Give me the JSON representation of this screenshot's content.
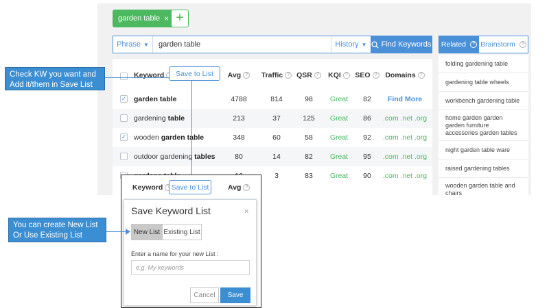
{
  "tag": {
    "label": "garden table",
    "close": "×"
  },
  "add_tag": "+",
  "search": {
    "mode": "Phrase",
    "query": "garden table",
    "history": "History",
    "find_button": "Find Keywords"
  },
  "table": {
    "columns": {
      "keyword": "Keyword",
      "save": "Save to List",
      "avg": "Avg",
      "traffic": "Traffic",
      "qsr": "QSR",
      "kqi": "KQI",
      "seo": "SEO",
      "domains": "Domains"
    },
    "rows": [
      {
        "checked": true,
        "kw_pre": "",
        "kw_bold": "garden table",
        "kw_post": "",
        "avg": "4788",
        "traffic": "814",
        "qsr": "98",
        "kqi": "Great",
        "seo": "82",
        "domains": "Find More"
      },
      {
        "checked": false,
        "kw_pre": "gardening ",
        "kw_bold": "table",
        "kw_post": "",
        "avg": "213",
        "traffic": "37",
        "qsr": "125",
        "kqi": "Great",
        "seo": "86",
        "domains": ".com .net .org"
      },
      {
        "checked": true,
        "kw_pre": "wooden ",
        "kw_bold": "garden table",
        "kw_post": "",
        "avg": "348",
        "traffic": "60",
        "qsr": "58",
        "kqi": "Great",
        "seo": "92",
        "domains": ".com .net .org"
      },
      {
        "checked": false,
        "kw_pre": "outdoor gardening ",
        "kw_bold": "tables",
        "kw_post": "",
        "avg": "80",
        "traffic": "14",
        "qsr": "82",
        "kqi": "Great",
        "seo": "95",
        "domains": ".com .net .org"
      },
      {
        "checked": false,
        "kw_pre": "",
        "kw_bold": "gardens table",
        "kw_post": "",
        "avg": "16",
        "traffic": "3",
        "qsr": "83",
        "kqi": "Great",
        "seo": "90",
        "domains": ".com .net .org"
      }
    ]
  },
  "related": {
    "tab_related": "Related",
    "tab_brainstorm": "Brainstorm",
    "items": [
      "folding gardening table",
      "gardening table wheels",
      "workbench gardening table",
      "home garden garden garden furniture accessories garden tables",
      "night garden table ware",
      "raised gardening tables",
      "wooden garden table and chairs"
    ]
  },
  "callouts": {
    "top": "Check KW you want and Add it/them in Save List",
    "bottom": "You can create New List Or Use Existing List"
  },
  "popup": {
    "keyword": "Keyword",
    "save": "Save to List",
    "avg": "Avg",
    "title": "Save Keyword List",
    "close": "×",
    "new_list": "New List",
    "existing_list": "Existing List",
    "label": "Enter a name for your new List :",
    "placeholder": "e.g. My keywords",
    "cancel": "Cancel",
    "save_btn": "Save"
  },
  "colors": {
    "accent": "#4a90d9",
    "green": "#4cb85f",
    "callout": "#3b8ed2"
  }
}
